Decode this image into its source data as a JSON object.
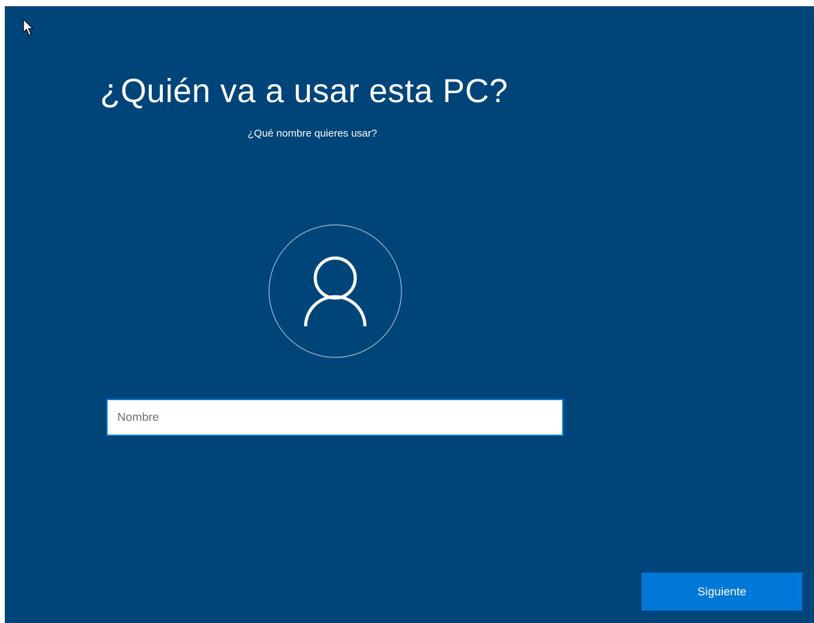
{
  "setup": {
    "title": "¿Quién va a usar esta PC?",
    "subtitle": "¿Qué nombre quieres usar?",
    "name_placeholder": "Nombre",
    "name_value": "",
    "next_label": "Siguiente"
  },
  "icons": {
    "avatar": "user-avatar-icon",
    "cursor": "mouse-pointer-icon"
  },
  "colors": {
    "background": "#00457a",
    "accent": "#0078d7",
    "text": "#ffffff"
  }
}
